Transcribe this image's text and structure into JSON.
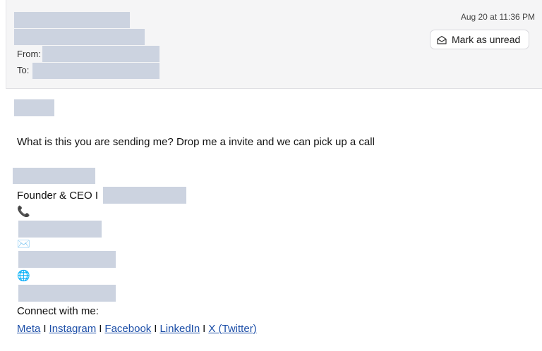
{
  "header": {
    "from_label": "From:",
    "to_label": "To:",
    "timestamp": "Aug 20 at 11:36 PM",
    "mark_unread_label": "Mark as unread",
    "mark_unread_icon": "envelope-open-icon"
  },
  "message": {
    "body": "What is this you are sending me? Drop me a invite and we can pick up a call",
    "signature": {
      "title": "Founder & CEO I",
      "phone_icon": "📞",
      "email_icon": "✉️",
      "web_icon": "🌐",
      "connect_label": "Connect with me:",
      "links": {
        "meta": "Meta",
        "instagram": "Instagram",
        "facebook": "Facebook",
        "linkedin": "LinkedIn",
        "x": "X (Twitter)"
      },
      "separator": "I"
    }
  }
}
